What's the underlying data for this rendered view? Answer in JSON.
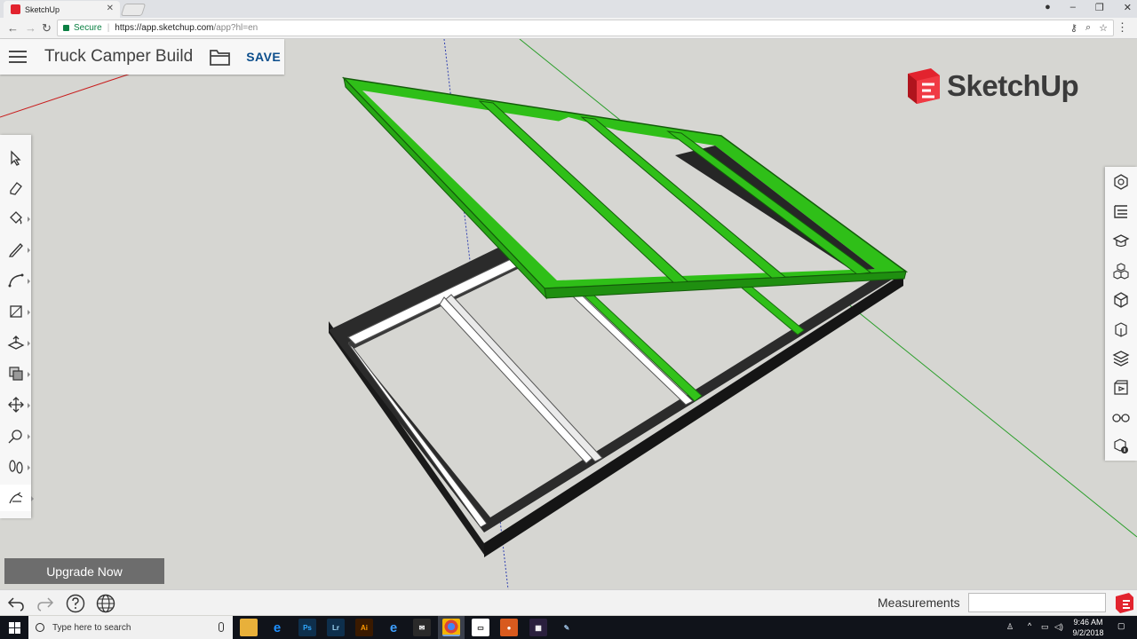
{
  "browser": {
    "tab_title": "SketchUp",
    "url_secure": "Secure",
    "url_host": "https://app.sketchup.com",
    "url_path": "/app?hl=en"
  },
  "app": {
    "doc_title": "Truck Camper Build",
    "save_label": "SAVE",
    "logo_text": "SketchUp",
    "upgrade_label": "Upgrade Now",
    "measurements_label": "Measurements",
    "measurements_value": ""
  },
  "left_tools": [
    {
      "name": "select-tool"
    },
    {
      "name": "eraser-tool"
    },
    {
      "name": "paint-bucket-tool"
    },
    {
      "name": "line-tool"
    },
    {
      "name": "arc-tool"
    },
    {
      "name": "rectangle-tool"
    },
    {
      "name": "push-pull-tool"
    },
    {
      "name": "offset-tool"
    },
    {
      "name": "move-tool"
    },
    {
      "name": "tape-measure-tool"
    },
    {
      "name": "walk-tool"
    },
    {
      "name": "orbit-tool"
    }
  ],
  "right_panels": [
    "entity-info-icon",
    "outliner-icon",
    "instructor-icon",
    "components-icon",
    "materials-icon",
    "scenes-icon",
    "layers-icon",
    "animation-icon",
    "display-icon",
    "model-info-icon"
  ],
  "taskbar": {
    "search_placeholder": "Type here to search",
    "time": "9:46 AM",
    "date": "9/2/2018"
  },
  "colors": {
    "frame_green": "#2fbf18",
    "frame_dark": "#242424",
    "accent_blue": "#0b4e8c",
    "logo_red": "#e2232e"
  }
}
